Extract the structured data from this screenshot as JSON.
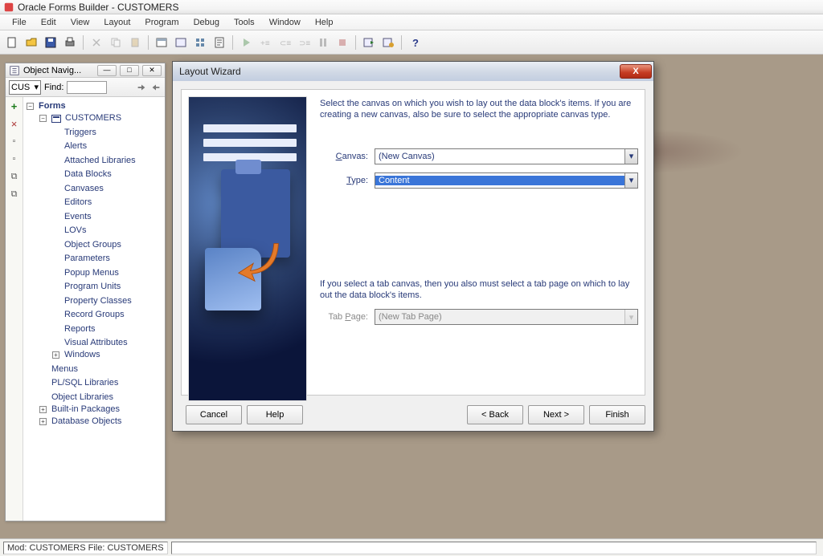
{
  "app": {
    "title": "Oracle Forms Builder - CUSTOMERS"
  },
  "menu": [
    "File",
    "Edit",
    "View",
    "Layout",
    "Program",
    "Debug",
    "Tools",
    "Window",
    "Help"
  ],
  "navigator": {
    "title": "Object Navig...",
    "selector_value": "CUS",
    "find_label": "Find:",
    "side_tools": [
      {
        "name": "add-icon",
        "glyph": "+",
        "color": "#1a7a1a"
      },
      {
        "name": "delete-icon",
        "glyph": "×",
        "color": "#a33"
      },
      {
        "name": "expand-icon",
        "glyph": "▫",
        "color": "#777"
      },
      {
        "name": "collapse-icon",
        "glyph": "▫",
        "color": "#777"
      },
      {
        "name": "copy-icon",
        "glyph": "⧉",
        "color": "#777"
      },
      {
        "name": "paste-icon",
        "glyph": "⧉",
        "color": "#777"
      }
    ],
    "root_label": "Forms",
    "module_label": "CUSTOMERS",
    "module_children": [
      "Triggers",
      "Alerts",
      "Attached Libraries",
      "Data Blocks",
      "Canvases",
      "Editors",
      "Events",
      "LOVs",
      "Object Groups",
      "Parameters",
      "Popup Menus",
      "Program Units",
      "Property Classes",
      "Record Groups",
      "Reports",
      "Visual Attributes"
    ],
    "module_last_child": "Windows",
    "form_siblings": [
      "Menus",
      "PL/SQL Libraries",
      "Object Libraries"
    ],
    "form_siblings_exp": [
      "Built-in Packages",
      "Database Objects"
    ]
  },
  "wizard": {
    "title": "Layout Wizard",
    "intro": "Select the canvas on which you wish to lay out the data block's items. If you are creating a new canvas, also be sure to select the appropriate canvas type.",
    "canvas_label_pre": "C",
    "canvas_label_post": "anvas:",
    "canvas_value": "(New Canvas)",
    "type_label_pre": "T",
    "type_label_post": "ype:",
    "type_value": "Content",
    "tab_note": "If you select a tab canvas, then you also must select a tab page on which to lay out the data block's items.",
    "tabpage_label_pre": "Tab ",
    "tabpage_label_u": "P",
    "tabpage_label_post": "age:",
    "tabpage_value": "(New Tab Page)",
    "buttons": {
      "cancel": "Cancel",
      "help": "Help",
      "back": "< Back",
      "next": "Next >",
      "finish": "Finish"
    }
  },
  "status": {
    "text": "Mod: CUSTOMERS File: CUSTOMERS"
  }
}
